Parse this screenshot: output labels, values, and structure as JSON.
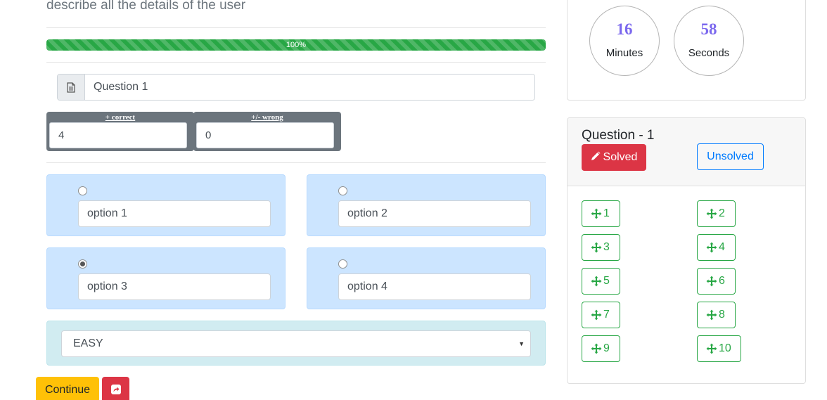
{
  "question": {
    "text": "describe all the details of the user",
    "progress_label": "100%",
    "progress_value": 100,
    "title_value": "Question 1"
  },
  "scoring": {
    "correct_label": "+ correct",
    "correct_value": "4",
    "wrong_label": "+/- wrong",
    "wrong_value": "0"
  },
  "options": [
    {
      "value": "option 1",
      "selected": false
    },
    {
      "value": "option 2",
      "selected": false
    },
    {
      "value": "option 3",
      "selected": true
    },
    {
      "value": "option 4",
      "selected": false
    }
  ],
  "difficulty": {
    "selected": "EASY"
  },
  "actions": {
    "continue_label": "Continue"
  },
  "timer": {
    "minutes": "16",
    "minutes_label": "Minutes",
    "seconds": "58",
    "seconds_label": "Seconds"
  },
  "question_panel": {
    "title": "Question - 1",
    "solved_label": "Solved",
    "unsolved_label": "Unsolved",
    "nav_items": [
      "1",
      "2",
      "3",
      "4",
      "5",
      "6",
      "7",
      "8",
      "9",
      "10"
    ]
  },
  "colors": {
    "progress": "#28a745",
    "option_bg": "#cce5ff",
    "difficulty_bg": "#d1ecf1",
    "continue": "#ffc107",
    "danger": "#dc3545",
    "primary": "#007bff",
    "timer_number": "#7b68ee"
  },
  "icons": {
    "question_prepend": "file-text-icon",
    "solved": "pencil-icon",
    "share": "share-square-icon",
    "nav": "arrows-move-icon",
    "select": "caret-down-icon"
  }
}
